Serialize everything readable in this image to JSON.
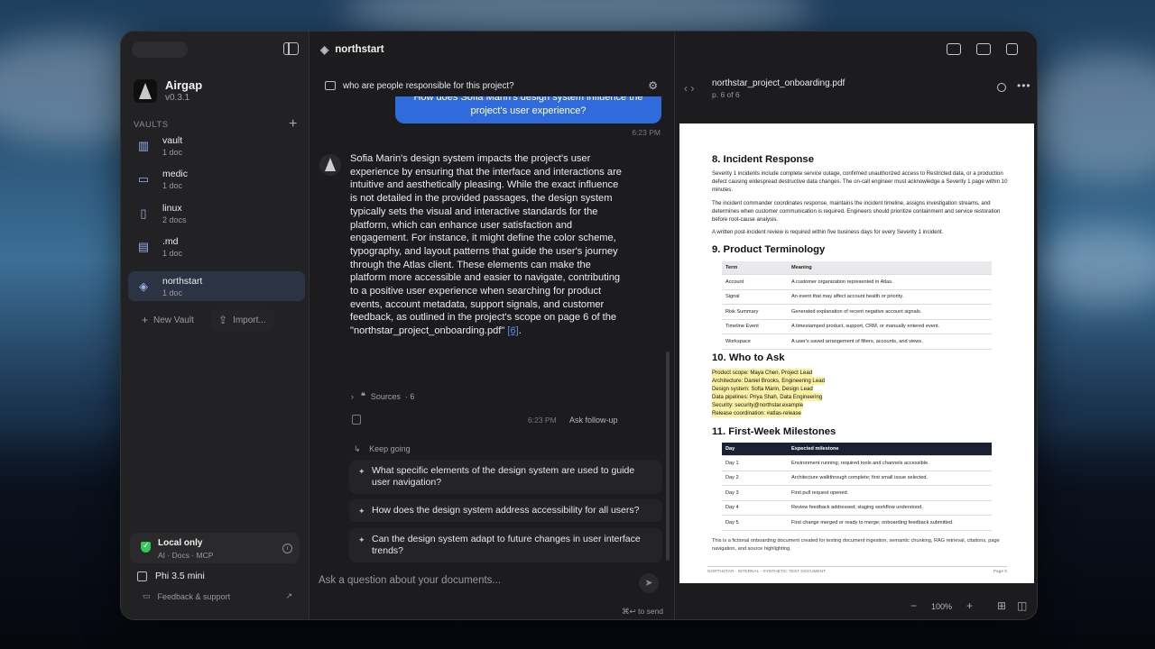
{
  "sidebar": {
    "brand_name": "Airgap",
    "version": "v0.3.1",
    "vaults_header": "VAULTS",
    "vaults": [
      {
        "name": "vault",
        "count": "1 doc",
        "icon": "chart-icon"
      },
      {
        "name": "medic",
        "count": "1 doc",
        "icon": "folder-icon"
      },
      {
        "name": "linux",
        "count": "2 docs",
        "icon": "document-icon"
      },
      {
        "name": ".md",
        "count": "1 doc",
        "icon": "archive-icon"
      },
      {
        "name": "northstart",
        "count": "1 doc",
        "icon": "graduation-cap-icon"
      }
    ],
    "new_vault": "New Vault",
    "import": "Import...",
    "status_title": "Local only",
    "status_sub": "AI · Docs · MCP",
    "model": "Phi 3.5 mini",
    "feedback": "Feedback & support"
  },
  "chat": {
    "title": "northstart",
    "query": "who are people responsible for this project?",
    "user_message": "How does Sofia Marin's design system influence the project's user experience?",
    "user_time": "6:23 PM",
    "answer": "Sofia Marin's design system impacts the project's user experience by ensuring that the interface and interactions are intuitive and aesthetically pleasing. While the exact influence is not detailed in the provided passages, the design system typically sets the visual and interactive standards for the platform, which can enhance user satisfaction and engagement. For instance, it might define the color scheme, typography, and layout patterns that guide the user's journey through the Atlas client. These elements can make the platform more accessible and easier to navigate, contributing to a positive user experience when searching for product events, account metadata, support signals, and customer feedback, as outlined in the project's scope on page 6 of the \"northstar_project_onboarding.pdf\" ",
    "citation": "[6]",
    "answer_end": ".",
    "sources_label": "Sources",
    "sources_count": "· 6",
    "answer_time": "6:23 PM",
    "ask_followup": "Ask follow-up",
    "keep_going": "Keep going",
    "suggestions": [
      "What specific elements of the design system are used to guide user navigation?",
      "How does the design system address accessibility for all users?",
      "Can the design system adapt to future changes in user interface trends?"
    ],
    "input_placeholder": "Ask a question about your documents...",
    "send_hint": "⌘↩ to send"
  },
  "pdf": {
    "filename": "northstar_project_onboarding.pdf",
    "page_label": "p. 6 of 6",
    "zoom": "100%",
    "doc": {
      "h8": "8. Incident Response",
      "p8a": "Severity 1 incidents include complete service outage, confirmed unauthorized access to Restricted data, or a production defect causing widespread destructive data changes. The on-call engineer must acknowledge a Severity 1 page within 10 minutes.",
      "p8b": "The incident commander coordinates response, maintains the incident timeline, assigns investigation streams, and determines when customer communication is required. Engineers should prioritize containment and service restoration before root-cause analysis.",
      "p8c": "A written post-incident review is required within five business days for every Severity 1 incident.",
      "h9": "9. Product Terminology",
      "term_headers": [
        "Term",
        "Meaning"
      ],
      "terms": [
        [
          "Account",
          "A customer organization represented in Atlas."
        ],
        [
          "Signal",
          "An event that may affect account health or priority."
        ],
        [
          "Risk Summary",
          "Generated explanation of recent negative account signals."
        ],
        [
          "Timeline Event",
          "A timestamped product, support, CRM, or manually entered event."
        ],
        [
          "Workspace",
          "A user's saved arrangement of filters, accounts, and views."
        ]
      ],
      "h10": "10. Who to Ask",
      "who": [
        "Product scope: Maya Chen, Project Lead",
        "Architecture: Daniel Brooks, Engineering Lead",
        "Design system: Sofia Marin, Design Lead",
        "Data pipelines: Priya Shah, Data Engineering",
        "Security: security@northstar.example",
        "Release coordination: #atlas-release"
      ],
      "h11": "11. First-Week Milestones",
      "milestone_headers": [
        "Day",
        "Expected milestone"
      ],
      "milestones": [
        [
          "Day 1",
          "Environment running; required tools and channels accessible."
        ],
        [
          "Day 2",
          "Architecture walkthrough complete; first small issue selected."
        ],
        [
          "Day 3",
          "First pull request opened."
        ],
        [
          "Day 4",
          "Review feedback addressed; staging workflow understood."
        ],
        [
          "Day 5",
          "First change merged or ready to merge; onboarding feedback submitted."
        ]
      ],
      "footnote": "This is a fictional onboarding document created for testing document ingestion, semantic chunking, RAG retrieval, citations, page navigation, and source highlighting.",
      "footer_left": "NORTHSTAR - INTERNAL - SYNTHETIC TEST DOCUMENT",
      "footer_right": "Page 6"
    }
  }
}
